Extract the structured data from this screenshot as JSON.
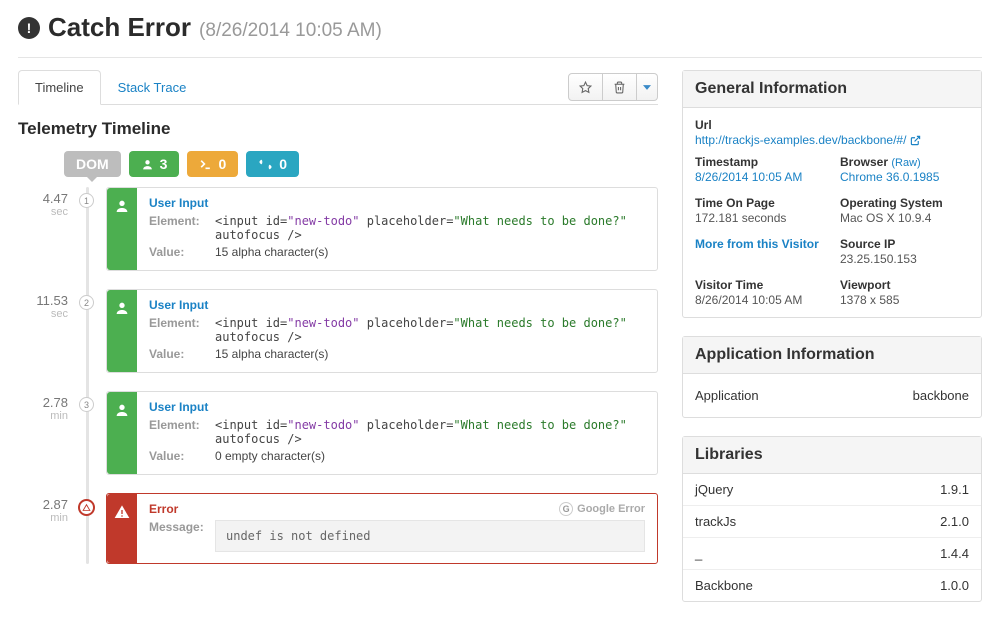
{
  "header": {
    "title": "Catch Error",
    "timestamp": "(8/26/2014 10:05 AM)"
  },
  "tabs": {
    "timeline": "Timeline",
    "stack": "Stack Trace"
  },
  "panel_title": "Telemetry Timeline",
  "pills": {
    "dom": "DOM",
    "users": "3",
    "console": "0",
    "network": "0"
  },
  "events": [
    {
      "time": "4.47",
      "unit": "sec",
      "num": "1",
      "title": "User Input",
      "element_pre": "<input id=",
      "element_id": "\"new-todo\"",
      "element_mid": " placeholder=",
      "element_attr": "\"What needs to be done?\"",
      "element_post": " autofocus />",
      "value": "15 alpha character(s)"
    },
    {
      "time": "11.53",
      "unit": "sec",
      "num": "2",
      "title": "User Input",
      "element_pre": "<input id=",
      "element_id": "\"new-todo\"",
      "element_mid": " placeholder=",
      "element_attr": "\"What needs to be done?\"",
      "element_post": " autofocus />",
      "value": "15 alpha character(s)"
    },
    {
      "time": "2.78",
      "unit": "min",
      "num": "3",
      "title": "User Input",
      "element_pre": "<input id=",
      "element_id": "\"new-todo\"",
      "element_mid": " placeholder=",
      "element_attr": "\"What needs to be done?\"",
      "element_post": " autofocus />",
      "value": "0 empty character(s)"
    }
  ],
  "error_event": {
    "time": "2.87",
    "unit": "min",
    "title": "Error",
    "msg_label": "Message:",
    "message": "undef is not defined",
    "google": "Google Error"
  },
  "labels": {
    "element": "Element:",
    "value": "Value:"
  },
  "side": {
    "general": {
      "heading": "General Information",
      "url_label": "Url",
      "url": "http://trackjs-examples.dev/backbone/#/",
      "timestamp_label": "Timestamp",
      "timestamp": "8/26/2014 10:05 AM",
      "browser_label": "Browser",
      "browser_raw": "(Raw)",
      "browser": "Chrome 36.0.1985",
      "time_on_page_label": "Time On Page",
      "time_on_page": "172.181 seconds",
      "os_label": "Operating System",
      "os": "Mac OS X 10.9.4",
      "more_visitor": "More from this Visitor",
      "source_ip_label": "Source IP",
      "source_ip": "23.25.150.153",
      "visitor_time_label": "Visitor Time",
      "visitor_time": "8/26/2014 10:05 AM",
      "viewport_label": "Viewport",
      "viewport": "1378 x 585"
    },
    "app": {
      "heading": "Application Information",
      "label": "Application",
      "value": "backbone"
    },
    "libs": {
      "heading": "Libraries",
      "rows": [
        {
          "name": "jQuery",
          "ver": "1.9.1"
        },
        {
          "name": "trackJs",
          "ver": "2.1.0"
        },
        {
          "name": "_",
          "ver": "1.4.4"
        },
        {
          "name": "Backbone",
          "ver": "1.0.0"
        }
      ]
    }
  }
}
